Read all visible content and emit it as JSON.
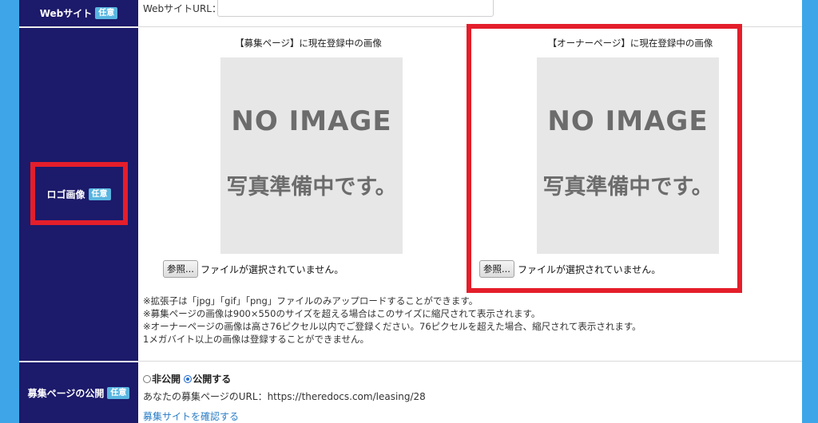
{
  "website": {
    "label": "Webサイト",
    "badge": "任意",
    "url_label": "WebサイトURL：",
    "url_value": ""
  },
  "logo": {
    "label": "ロゴ画像",
    "badge": "任意",
    "recruit": {
      "caption": "【募集ページ】に現在登録中の画像",
      "image_text": "NO IMAGE",
      "image_subtext": "写真準備中です。",
      "browse_label": "参照...",
      "no_file": "ファイルが選択されていません。"
    },
    "owner": {
      "caption": "【オーナーページ】に現在登録中の画像",
      "image_text": "NO IMAGE",
      "image_subtext": "写真準備中です。",
      "browse_label": "参照...",
      "no_file": "ファイルが選択されていません。"
    },
    "notes": [
      "※拡張子は「jpg」「gif」「png」ファイルのみアップロードすることができます。",
      "※募集ページの画像は900×550のサイズを超える場合はこのサイズに縮尺されて表示されます。",
      "※オーナーページの画像は高さ76ピクセル以内でご登録ください。76ピクセルを超えた場合、縮尺されて表示されます。",
      "1メガバイト以上の画像は登録することができません。"
    ]
  },
  "publish": {
    "label": "募集ページの公開",
    "badge": "任意",
    "option_private": "非公開",
    "option_public": "公開する",
    "selected": "公開する",
    "url_text": "あなたの募集ページのURL：https://theredocs.com/leasing/28",
    "confirm_link": "募集サイトを確認する"
  },
  "colors": {
    "label_bg": "#1c1a6a",
    "badge_bg": "#59b6e0",
    "highlight": "#e41e2b",
    "page_bg": "#3ea6e8",
    "link": "#2b7ec6"
  }
}
